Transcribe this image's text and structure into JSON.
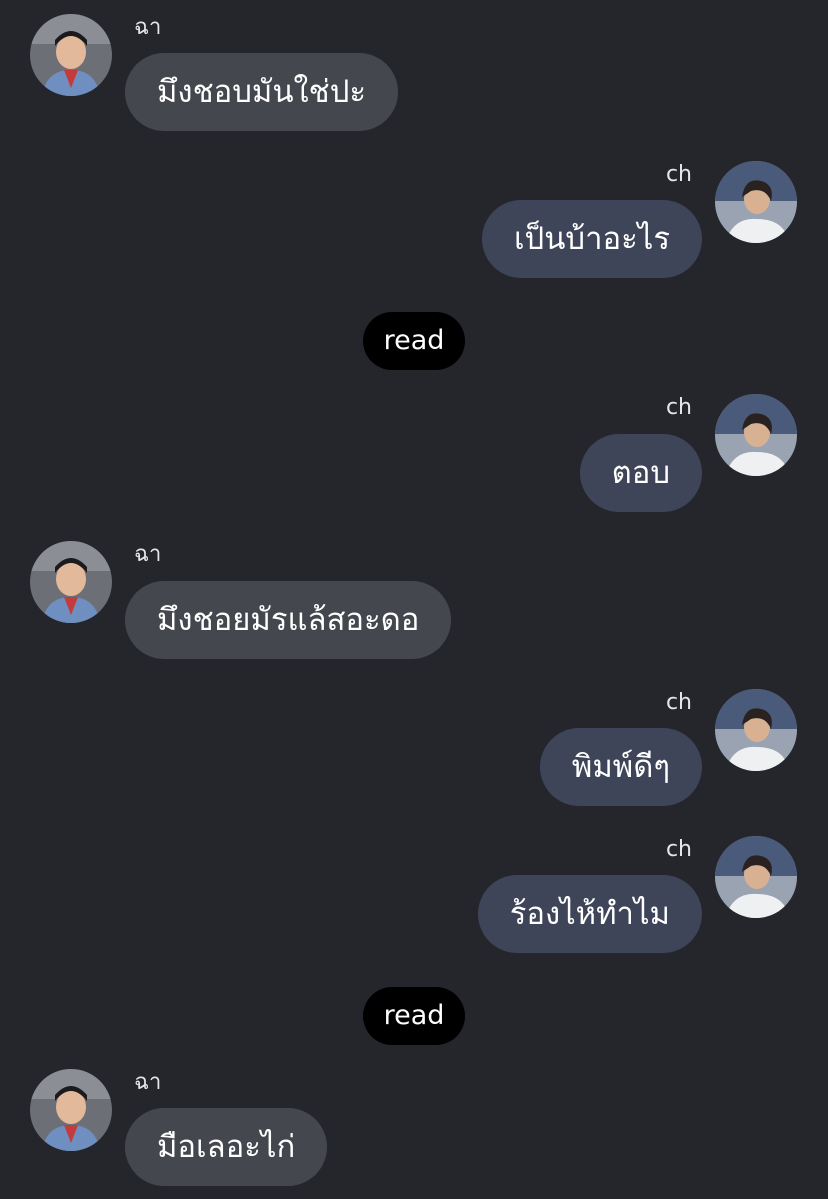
{
  "chat": {
    "messages": [
      {
        "sender": "ฉา",
        "text": "มึงชอบมันใช่ปะ",
        "side": "left"
      },
      {
        "sender": "ch",
        "text": "เป็นบ้าอะไร",
        "side": "right"
      },
      {
        "status": "read"
      },
      {
        "sender": "ch",
        "text": "ตอบ",
        "side": "right"
      },
      {
        "sender": "ฉา",
        "text": "มึงชอยมัรแล้สอะดอ",
        "side": "left"
      },
      {
        "sender": "ch",
        "text": "พิมพ์ดีๆ",
        "side": "right"
      },
      {
        "sender": "ch",
        "text": "ร้องไห้ทำไม",
        "side": "right"
      },
      {
        "status": "read"
      },
      {
        "sender": "ฉา",
        "text": "มือเลอะไก่",
        "side": "left"
      }
    ]
  }
}
